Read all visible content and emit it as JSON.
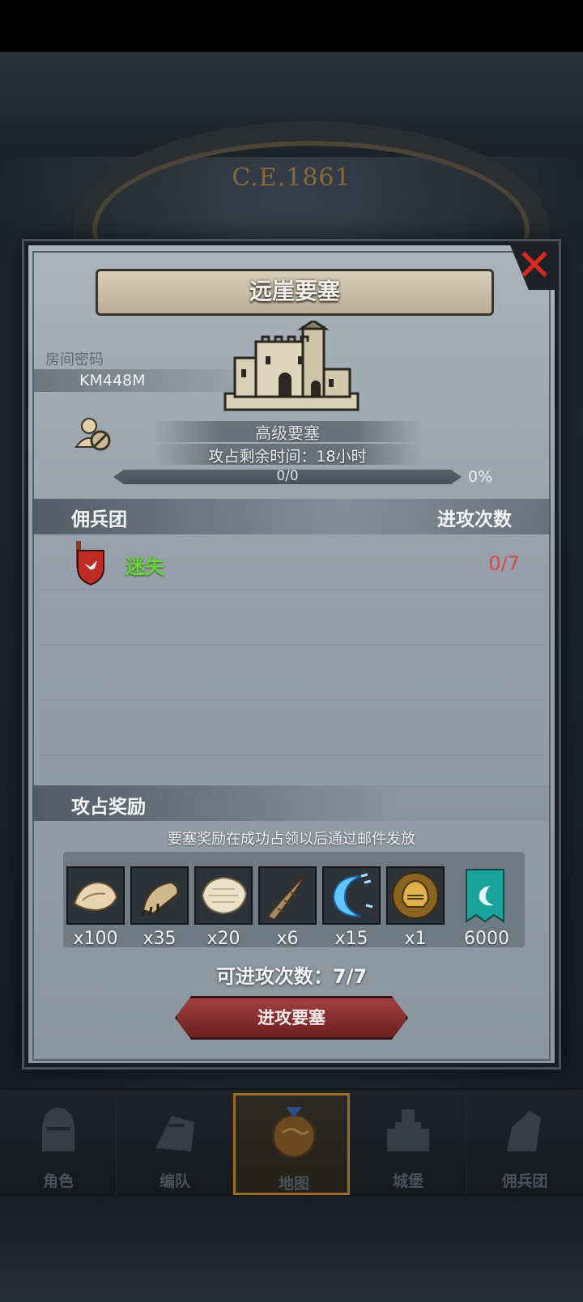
{
  "background": {
    "year": "C.E.1861"
  },
  "dialog": {
    "title": "远崖要塞",
    "room": {
      "label": "房间密码",
      "code": "KM448M"
    },
    "fortress_type": "高级要塞",
    "capture_time": {
      "label": "攻占剩余时间：",
      "value": "18小时"
    },
    "progress": {
      "count": "0/0",
      "percent": "0%",
      "fraction": 0
    },
    "mercenary_header": {
      "title": "佣兵团",
      "attack_count_title": "进攻次数"
    },
    "guilds": [
      {
        "name": "迷失",
        "attacks": "0/7"
      }
    ],
    "rewards": {
      "title": "攻占奖励",
      "note": "要塞奖励在成功占领以后通过邮件发放",
      "items": [
        {
          "icon": "fur-pelt-icon",
          "qty": "x100"
        },
        {
          "icon": "beast-claw-icon",
          "qty": "x35"
        },
        {
          "icon": "white-hide-icon",
          "qty": "x20"
        },
        {
          "icon": "horn-icon",
          "qty": "x6"
        },
        {
          "icon": "blue-crescent-icon",
          "qty": "x15"
        },
        {
          "icon": "golden-helmet-icon",
          "qty": "x1"
        },
        {
          "icon": "teal-banner-icon",
          "qty": "6000"
        }
      ]
    },
    "attempts": "可进攻次数：7/7",
    "attack_button": "进攻要塞"
  },
  "nav": {
    "items": [
      {
        "label": "角色",
        "icon": "knight-helmet-icon"
      },
      {
        "label": "编队",
        "icon": "formation-icon"
      },
      {
        "label": "地图",
        "icon": "map-globe-icon",
        "active": true
      },
      {
        "label": "城堡",
        "icon": "castle-icon"
      },
      {
        "label": "佣兵团",
        "icon": "mercenary-icon"
      }
    ]
  },
  "colors": {
    "guild_name": "#6bd33d",
    "attack_count": "#d84a4a",
    "close": "#d42a22",
    "button": "#8a2f2f"
  }
}
